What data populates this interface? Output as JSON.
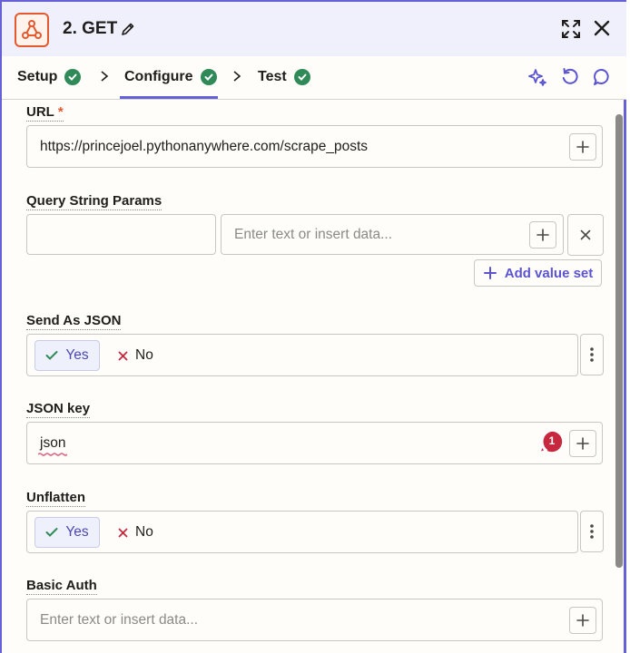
{
  "header": {
    "title": "2. GET",
    "icons": {
      "app": "webhook-icon",
      "edit": "pencil-icon",
      "expand": "expand-icon",
      "close": "close-icon"
    }
  },
  "tabs": [
    {
      "label": "Setup",
      "complete": true
    },
    {
      "label": "Configure",
      "complete": true,
      "active": true
    },
    {
      "label": "Test",
      "complete": true
    }
  ],
  "toolbar_icons": [
    "sparkle-icon",
    "refresh-icon",
    "comment-icon"
  ],
  "form": {
    "url": {
      "label": "URL",
      "required_mark": "*",
      "value": "https://princejoel.pythonanywhere.com/scrape_posts"
    },
    "query_params": {
      "label": "Query String Params",
      "key_value": "",
      "value_placeholder": "Enter text or insert data...",
      "add_label": "Add value set"
    },
    "send_as_json": {
      "label": "Send As JSON",
      "yes": "Yes",
      "no": "No",
      "selected": "Yes"
    },
    "json_key": {
      "label": "JSON key",
      "value": "json",
      "error_count": "1"
    },
    "unflatten": {
      "label": "Unflatten",
      "yes": "Yes",
      "no": "No",
      "selected": "Yes"
    },
    "basic_auth": {
      "label": "Basic Auth",
      "placeholder": "Enter text or insert data..."
    }
  },
  "colors": {
    "accent": "#6660d6",
    "success": "#2f8a57",
    "brand": "#e5592e",
    "error": "#c8283e"
  }
}
